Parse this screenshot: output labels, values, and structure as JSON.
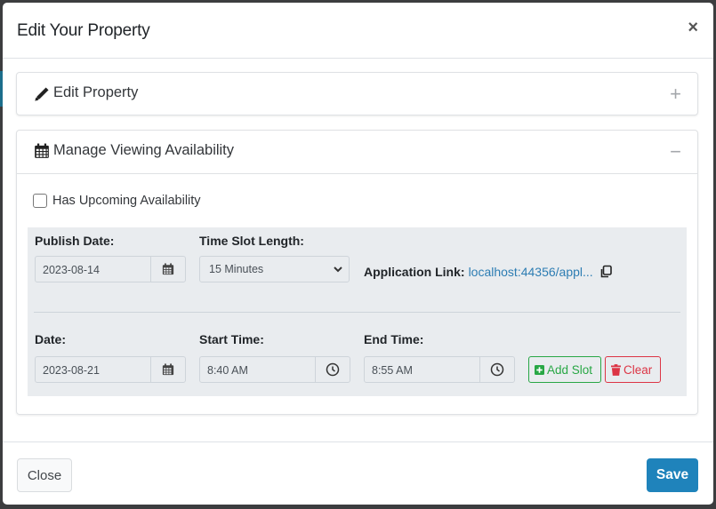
{
  "modal": {
    "title": "Edit Your Property",
    "close_icon": "close-icon"
  },
  "sections": [
    {
      "title": "Edit Property",
      "icon": "pencil-icon",
      "toggle": "+",
      "expanded": false
    },
    {
      "title": "Manage Viewing Availability",
      "icon": "calendar-icon",
      "toggle": "−",
      "expanded": true
    }
  ],
  "availability": {
    "has_upcoming_label": "Has Upcoming Availability",
    "has_upcoming_checked": false,
    "publish_date_label": "Publish Date:",
    "publish_date_value": "2023-08-14",
    "time_slot_label": "Time Slot Length:",
    "time_slot_value": "15 Minutes",
    "application_link_label": "Application Link:",
    "application_link_text": "localhost:44356/appl...",
    "date_label": "Date:",
    "date_value": "2023-08-21",
    "start_time_label": "Start Time:",
    "start_time_value": "8:40 AM",
    "end_time_label": "End Time:",
    "end_time_value": "8:55 AM",
    "add_slot_label": "Add Slot",
    "clear_label": "Clear"
  },
  "footer": {
    "close_label": "Close",
    "save_label": "Save"
  },
  "colors": {
    "primary": "#1f83bb",
    "success": "#28a745",
    "danger": "#dc3545",
    "link": "#2d7db3"
  }
}
